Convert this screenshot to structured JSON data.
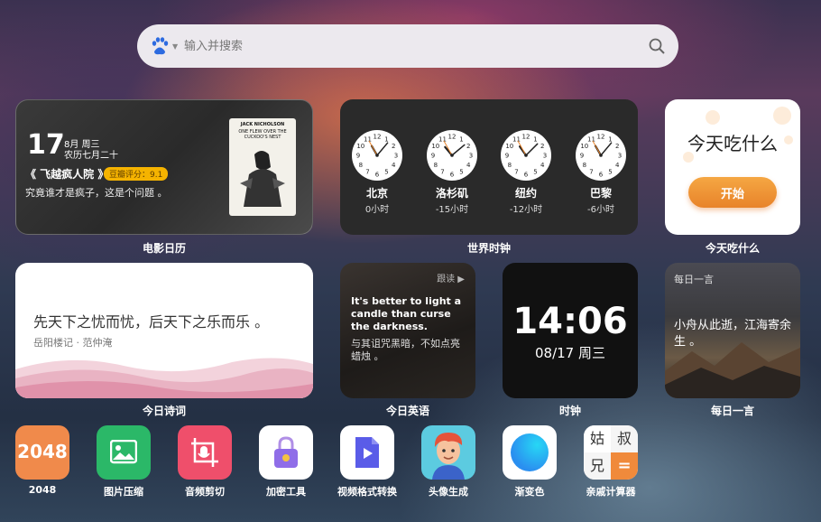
{
  "search": {
    "placeholder": "输入并搜索",
    "engine_icon": "baidu-paw-icon",
    "search_icon": "magnifier-icon"
  },
  "movie_calendar": {
    "day": "17",
    "month_week": "8月  周三",
    "lunar": "农历七月二十",
    "title": "《 飞越疯人院 》",
    "rating": "豆瓣评分：9.1",
    "quote": "究竟谁才是疯子，这是个问题 。",
    "poster_title": "JACK NICHOLSON",
    "poster_subtitle": "ONE FLEW OVER THE CUCKOO'S NEST",
    "caption": "电影日历"
  },
  "world_clock": {
    "caption": "世界时钟",
    "clocks": [
      {
        "city": "北京",
        "offset": "0小时"
      },
      {
        "city": "洛杉矶",
        "offset": "-15小时"
      },
      {
        "city": "纽约",
        "offset": "-12小时"
      },
      {
        "city": "巴黎",
        "offset": "-6小时"
      }
    ]
  },
  "food": {
    "question": "今天吃什么",
    "button": "开始",
    "caption": "今天吃什么"
  },
  "poem": {
    "line": "先天下之忧而忧，后天下之乐而乐 。",
    "source": "岳阳楼记 · 范仲淹",
    "caption": "今日诗词"
  },
  "english": {
    "follow": "跟读 ▶",
    "en": "It's better to light a candle than curse the darkness.",
    "cn": "与其诅咒黑暗，不如点亮蜡烛 。",
    "caption": "今日英语"
  },
  "clock": {
    "time": "14:06",
    "date": "08/17 周三",
    "caption": "时钟"
  },
  "daily": {
    "header": "每日一言",
    "text": "小舟从此逝，江海寄余生 。",
    "caption": "每日一言"
  },
  "apps": [
    {
      "label": "2048",
      "icon": "2048-tile-icon",
      "color": "#f08a4b"
    },
    {
      "label": "图片压缩",
      "icon": "image-icon",
      "color": "#2bb868"
    },
    {
      "label": "音频剪切",
      "icon": "microphone-crop-icon",
      "color": "#ef4f6b"
    },
    {
      "label": "加密工具",
      "icon": "lock-icon",
      "color": "#ffffff"
    },
    {
      "label": "视频格式转换",
      "icon": "video-file-icon",
      "color": "#ffffff"
    },
    {
      "label": "头像生成",
      "icon": "avatar-face-icon",
      "color": "#5ccbe0"
    },
    {
      "label": "渐变色",
      "icon": "gradient-circle-icon",
      "color": "#ffffff"
    },
    {
      "label": "亲戚计算器",
      "icon": "relative-calculator-icon",
      "color": "#ffffff"
    }
  ],
  "app_2048_text": "2048",
  "calc_chars": [
    "姑",
    "叔",
    "兄",
    "="
  ]
}
